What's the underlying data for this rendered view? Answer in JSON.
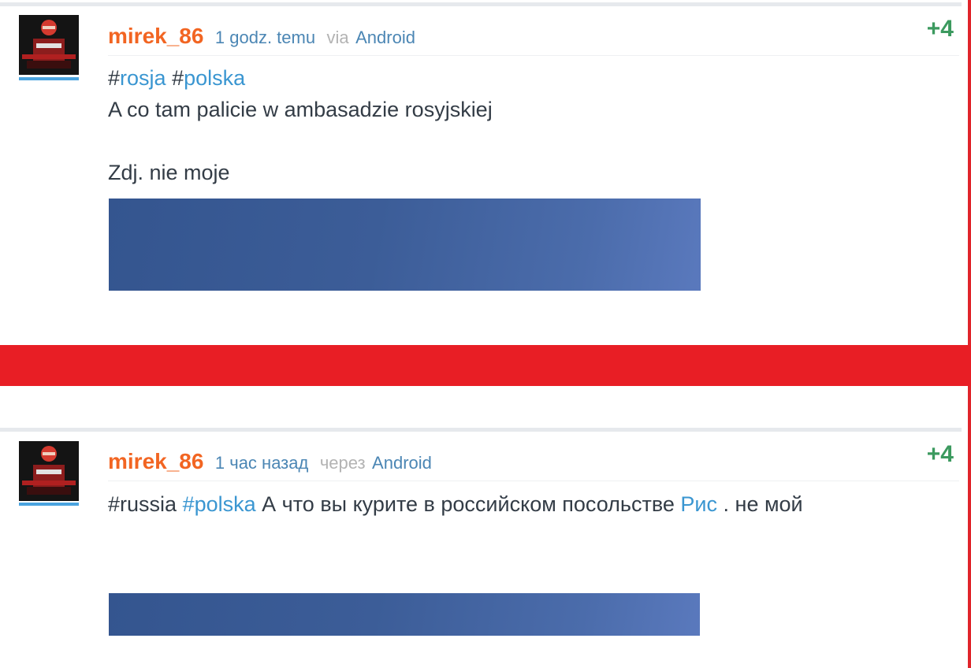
{
  "posts": [
    {
      "author": "mirek_86",
      "time": "1 godz. temu",
      "via": "via",
      "source": "Android",
      "votes": "+4",
      "tags_line": {
        "hash1": "#",
        "tag1": "rosja",
        "hash2": "#",
        "tag2": "polska"
      },
      "line1": "A co tam palicie w ambasadzie rosyjskiej",
      "line2": "Zdj. nie moje"
    },
    {
      "author": "mirek_86",
      "time": "1 час назад",
      "via": "через",
      "source": "Android",
      "votes": "+4",
      "tag_plain": "#russia",
      "tag_link": "#polska",
      "text_before_link": "А что вы курите в российском посольстве",
      "link": "Рис",
      "text_after_link": ". не мой"
    }
  ],
  "colors": {
    "divider": "#e81e25",
    "author": "#f26522",
    "votes": "#3c9a5f",
    "tag": "#3a96d1"
  },
  "icons": {
    "avatar": "avatar-image"
  }
}
